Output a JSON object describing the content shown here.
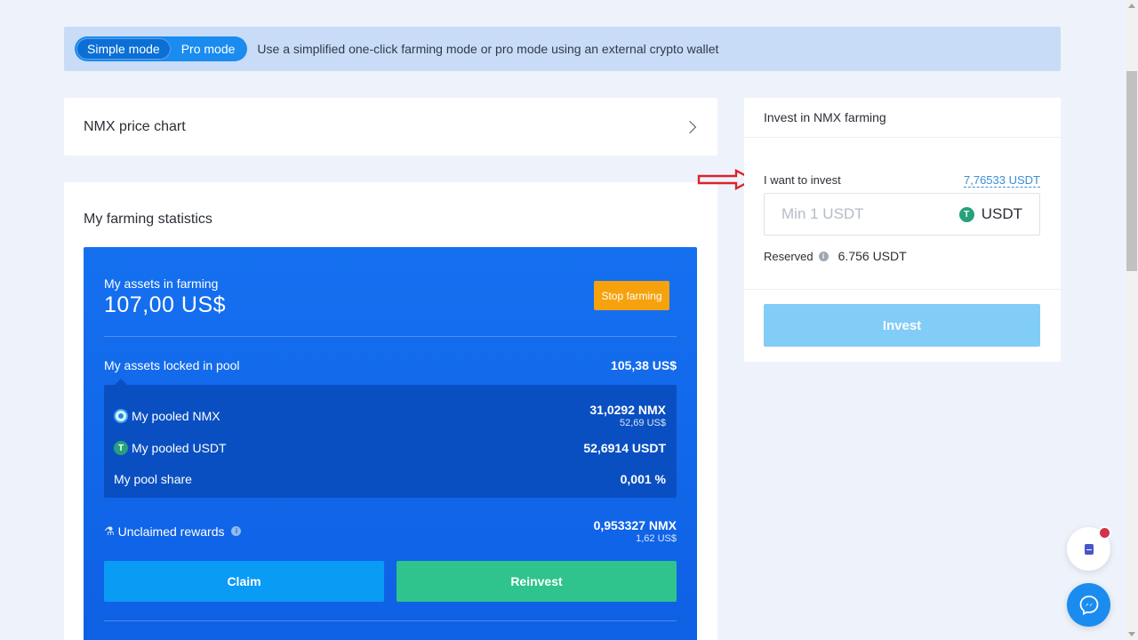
{
  "mode_banner": {
    "simple_label": "Simple mode",
    "pro_label": "Pro mode",
    "description": "Use a simplified one-click farming mode or pro mode using an external crypto wallet"
  },
  "price_chart": {
    "title": "NMX price chart"
  },
  "stats": {
    "title": "My farming statistics",
    "assets_label": "My assets in farming",
    "assets_value": "107,00 US$",
    "stop_label": "Stop farming",
    "locked_label": "My assets locked in pool",
    "locked_value": "105,38 US$",
    "pool": {
      "nmx_label": "My pooled NMX",
      "nmx_value": "31,0292 NMX",
      "nmx_usd": "52,69 US$",
      "usdt_label": "My pooled USDT",
      "usdt_value": "52,6914 USDT",
      "share_label": "My pool share",
      "share_value": "0,001 %"
    },
    "rewards_label": "Unclaimed rewards",
    "rewards_value": "0,953327 NMX",
    "rewards_usd": "1,62 US$",
    "claim_label": "Claim",
    "reinvest_label": "Reinvest"
  },
  "invest": {
    "header": "Invest in NMX farming",
    "want_label": "I want to invest",
    "balance": "7,76533 USDT",
    "placeholder": "Min 1 USDT",
    "currency": "USDT",
    "reserved_label": "Reserved",
    "reserved_value": "6.756 USDT",
    "button_label": "Invest"
  },
  "colors": {
    "accent": "#1a8cf0",
    "panel_blue": "#1570f0",
    "stop_orange": "#f5a20d",
    "reinvest_green": "#2fc48d",
    "annotation_red": "#d9232d"
  }
}
